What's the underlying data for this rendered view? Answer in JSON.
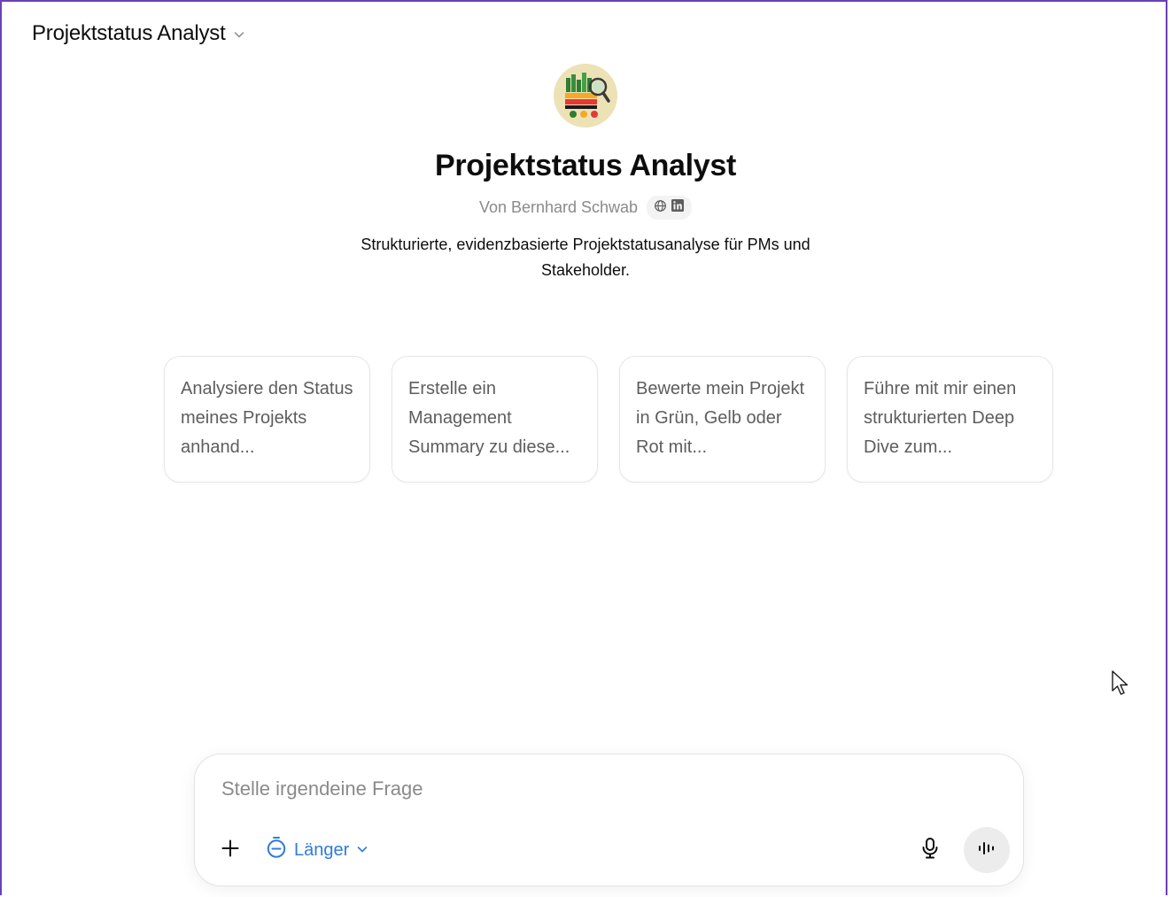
{
  "header": {
    "title": "Projektstatus Analyst",
    "dropdown_icon": "chevron-down-icon"
  },
  "gpt": {
    "avatar_icon": "traffic-light-chart-magnifier-icon",
    "title": "Projektstatus Analyst",
    "author": "Von Bernhard Schwab",
    "author_links": [
      "globe-icon",
      "linkedin-icon"
    ],
    "description": "Strukturierte, evidenzbasierte Projektstatusanalyse für PMs und Stakeholder."
  },
  "conversation_starters": [
    {
      "label": "Analysiere den Status meines Projekts anhand..."
    },
    {
      "label": "Erstelle ein Management Summary zu diese..."
    },
    {
      "label": "Bewerte mein Projekt in Grün, Gelb oder Rot mit..."
    },
    {
      "label": "Führe mit mir einen strukturierten Deep Dive zum..."
    }
  ],
  "composer": {
    "placeholder": "Stelle irgendeine Frage",
    "value": "",
    "mode_label": "Länger",
    "icons": [
      "plus-icon",
      "timer-icon",
      "chevron-down-icon",
      "microphone-icon",
      "voice-waveform-icon"
    ],
    "accent_color": "#2f7bdc"
  }
}
